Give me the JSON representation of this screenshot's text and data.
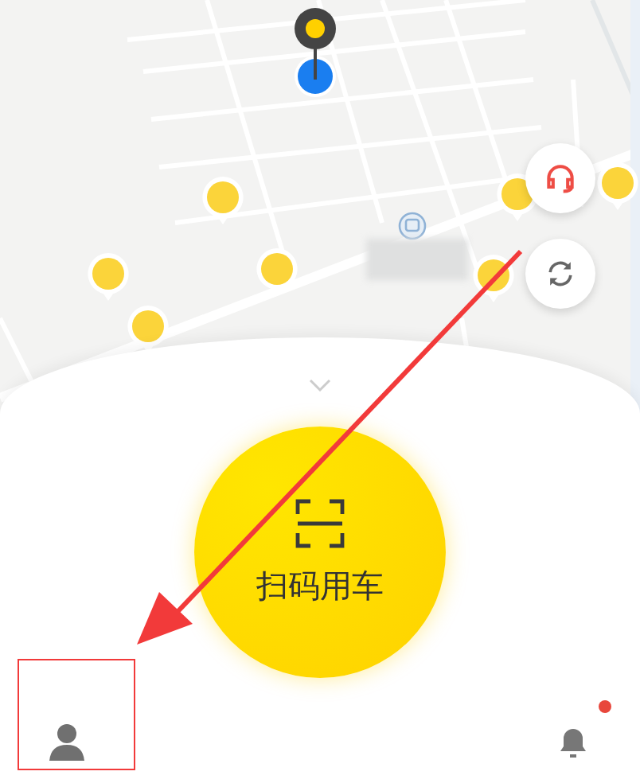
{
  "scan_button": {
    "label": "扫码用车"
  }
}
